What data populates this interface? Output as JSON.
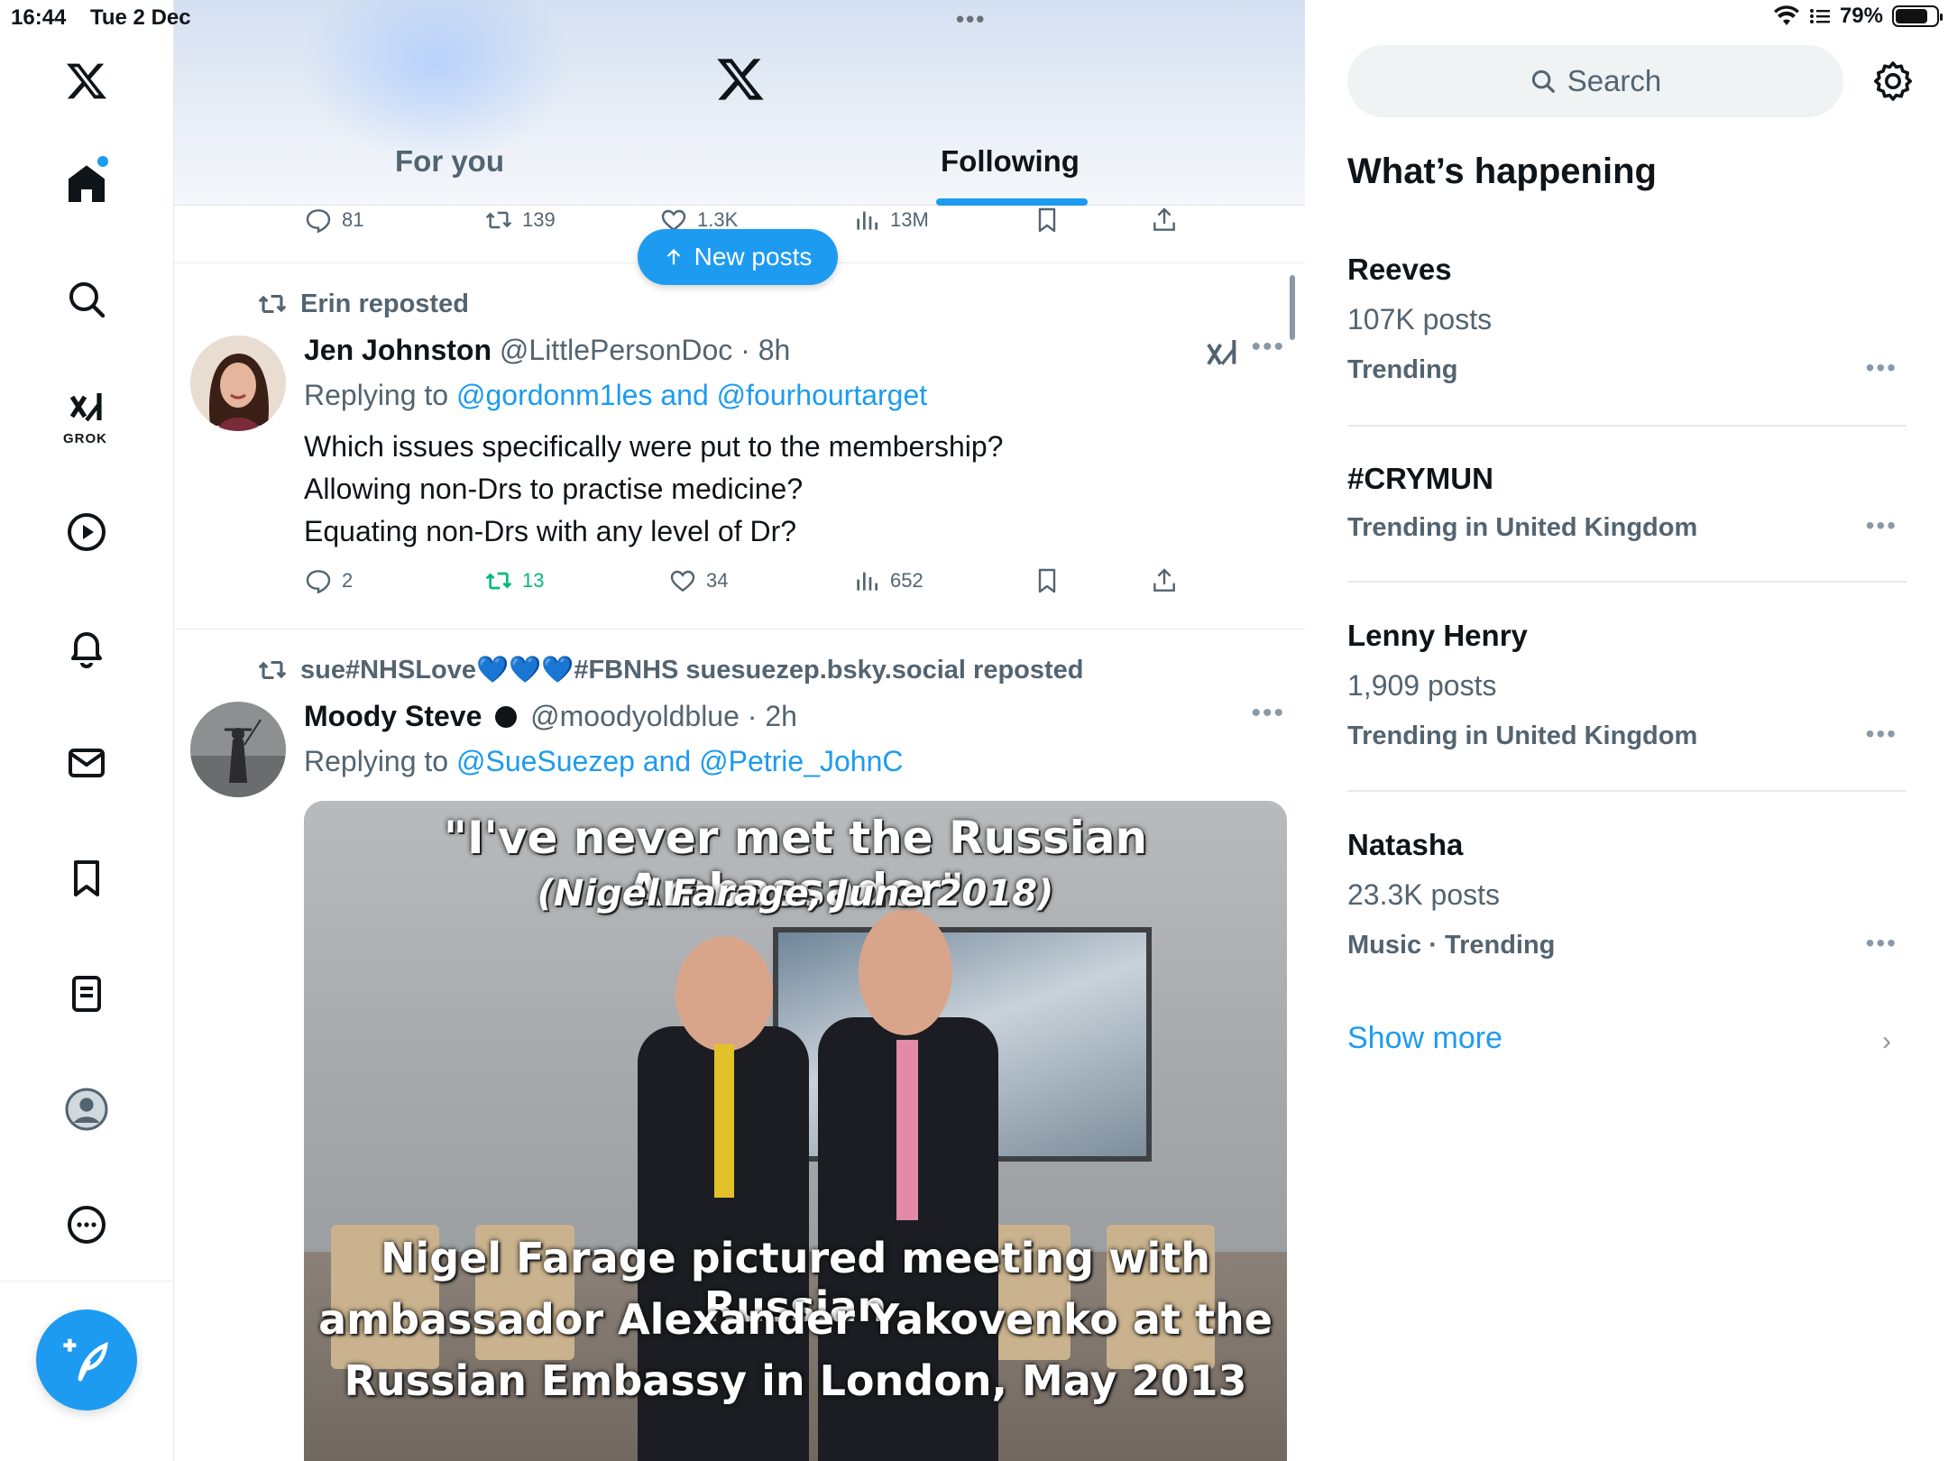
{
  "status_bar": {
    "time": "16:44",
    "date": "Tue 2 Dec",
    "battery": "79%",
    "battery_level": 0.79
  },
  "header": {
    "tabs": [
      {
        "label": "For you",
        "active": false
      },
      {
        "label": "Following",
        "active": true
      }
    ]
  },
  "new_posts_button": {
    "label": "New posts"
  },
  "prev_post_actions": {
    "replies": "81",
    "reposts": "139",
    "likes": "1.3K",
    "views": "13M"
  },
  "posts": [
    {
      "repost_by": "Erin reposted",
      "author_name": "Jen Johnston",
      "handle": "@LittlePersonDoc",
      "time": "8h",
      "replying_prefix": "Replying to",
      "replying_to": "@gordonm1les and @fourhourtarget",
      "text_lines": [
        "Which issues specifically were put to the membership?",
        "Allowing non-Drs to practise medicine?",
        "Equating non-Drs with any level of Dr?"
      ],
      "replies": "2",
      "reposts": "13",
      "likes": "34",
      "views": "652"
    },
    {
      "repost_by": "sue#NHSLove💙💙💙#FBNHS suesuezep.bsky.social reposted",
      "author_name": "Moody Steve",
      "handle": "@moodyoldblue",
      "time": "2h",
      "replying_prefix": "Replying to",
      "replying_to": "@SueSuezep and @Petrie_JohnC",
      "media": {
        "caption_top": "\"I've never met the Russian Ambassador\"",
        "caption_sub": "(Nigel Farage, June 2018)",
        "caption_bottom_lines": [
          "Nigel Farage pictured meeting with Russian",
          "ambassador Alexander Yakovenko at the",
          "Russian Embassy in London, May 2013"
        ]
      }
    }
  ],
  "sidebar": {
    "search_placeholder": "Search",
    "section_title": "What’s happening",
    "trends": [
      {
        "name": "Reeves",
        "count": "107K posts",
        "context": "Trending"
      },
      {
        "name": "#CRYMUN",
        "count": "",
        "context": "Trending in United Kingdom"
      },
      {
        "name": "Lenny Henry",
        "count": "1,909 posts",
        "context": "Trending in United Kingdom"
      },
      {
        "name": "Natasha",
        "count": "23.3K posts",
        "context": "Music · Trending"
      }
    ],
    "show_more": "Show more"
  },
  "left_nav": {
    "grok_label": "GROK"
  },
  "colors": {
    "accent": "#1d9bf0",
    "repost_green": "#00ba7c",
    "secondary_text": "#536471"
  }
}
